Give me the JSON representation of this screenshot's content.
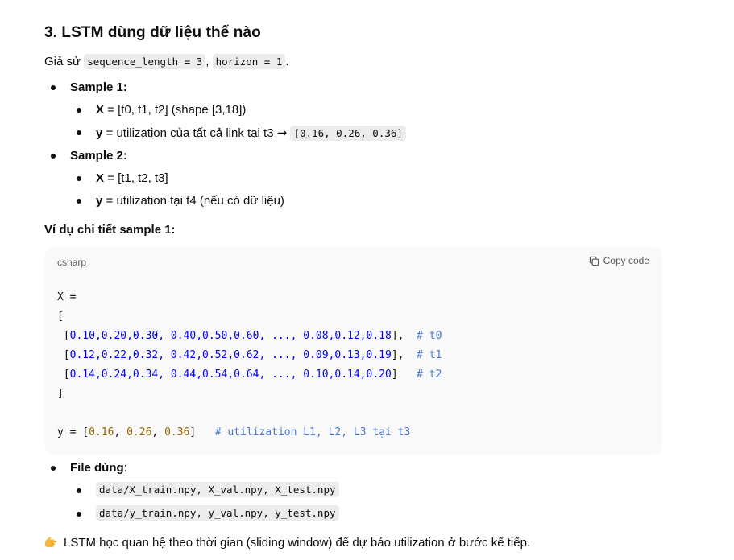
{
  "heading": "3. LSTM dùng dữ liệu thế nào",
  "intro": {
    "prefix": "Giả sử ",
    "code1": "sequence_length = 3",
    "sep": ", ",
    "code2": "horizon = 1",
    "suffix": "."
  },
  "samples": [
    {
      "label": "Sample 1:",
      "items": [
        {
          "key": "X",
          "text": " = [t0, t1, t2] (shape [3,18])"
        },
        {
          "key": "y",
          "text": " = utilization của tất cả link tại t3 ",
          "arrow": "→",
          "code": "[0.16, 0.26, 0.36]"
        }
      ]
    },
    {
      "label": "Sample 2:",
      "items": [
        {
          "key": "X",
          "text": " = [t1, t2, t3]"
        },
        {
          "key": "y",
          "text": " = utilization tại t4 (nếu có dữ liệu)"
        }
      ]
    }
  ],
  "detail_label": "Ví dụ chi tiết sample 1:",
  "codeblock": {
    "lang": "csharp",
    "copy_label": "Copy code",
    "lines": {
      "l1": "X =",
      "l2": "[",
      "r1": {
        "open": " [",
        "vals": "0.10,0.20,0.30, 0.40,0.50,0.60, ..., 0.08,0.12,0.18",
        "close": "],",
        "comment": "# t0"
      },
      "r2": {
        "open": " [",
        "vals": "0.12,0.22,0.32, 0.42,0.52,0.62, ..., 0.09,0.13,0.19",
        "close": "],",
        "comment": "# t1"
      },
      "r3": {
        "open": " [",
        "vals": "0.14,0.24,0.34, 0.44,0.54,0.64, ..., 0.10,0.14,0.20",
        "close": "]",
        "comment": "# t2"
      },
      "l6": "]",
      "y_prefix": "y = [",
      "y_vals": [
        "0.16",
        "0.26",
        "0.36"
      ],
      "y_close": "]",
      "y_comment": "# utilization L1, L2, L3 tại t3"
    }
  },
  "files": {
    "label": "File dùng",
    "colon": ":",
    "items": [
      "data/X_train.npy, X_val.npy, X_test.npy",
      "data/y_train.npy, y_val.npy, y_test.npy"
    ]
  },
  "footer": {
    "icon": "pointing-hand-icon",
    "text": "LSTM học quan hệ theo thời gian (sliding window) để dự báo utilization ở bước kế tiếp."
  }
}
